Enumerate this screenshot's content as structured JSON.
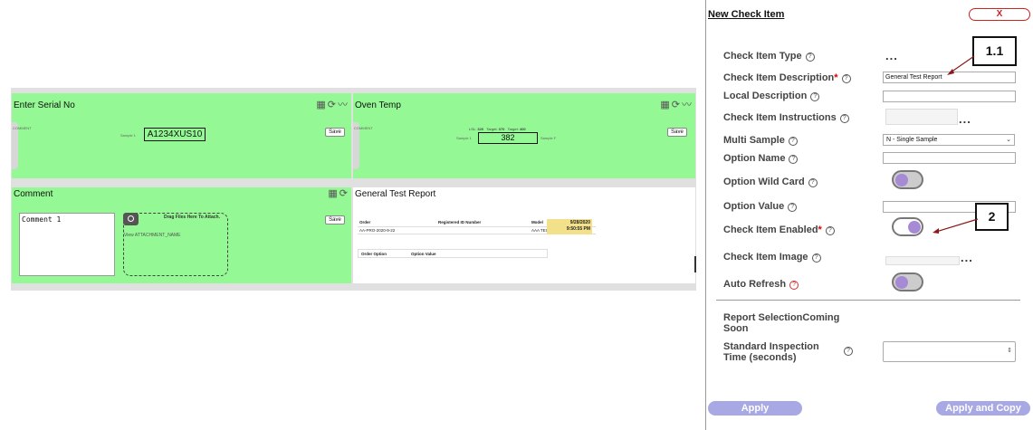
{
  "panels": {
    "serial": {
      "title": "Enter Serial No",
      "sample_label": "Sample 1",
      "value": "A1234XUS10",
      "save": "Save",
      "strip": "COMMENT"
    },
    "oven": {
      "title": "Oven Temp",
      "lsl_label": "LSL:",
      "lsl": "320",
      "target_label": "Target:",
      "target": "370",
      "usl_label": "Target:",
      "usl": "400",
      "sample_label": "Sample 1",
      "value": "382",
      "right_label": "Sample F",
      "save": "Save",
      "strip": "COMMENT"
    },
    "comment": {
      "title": "Comment",
      "value": "Comment 1",
      "drag_text": "Drag Files Here To Attach.",
      "view_attachment": "View ATTACHMENT_NAME",
      "save": "Save"
    },
    "report": {
      "title": "General Test Report",
      "headers": [
        "Order",
        "Registered ID Number",
        "Model"
      ],
      "row": [
        "AA-PRO-2020-9-22",
        "",
        "AAA TEST PRO"
      ],
      "date": "9/28/2020",
      "time": "9:50:55 PM",
      "option_headers": [
        "Order Option",
        "Option Value"
      ]
    },
    "icons": [
      "table-icon",
      "refresh-icon",
      "chart-icon"
    ]
  },
  "dialog": {
    "title": "New Check Item",
    "close": "X",
    "fields": {
      "type": {
        "label": "Check Item Type",
        "value": "..."
      },
      "description": {
        "label": "Check Item Description",
        "required": "*",
        "value": "General Test Report"
      },
      "local_description": {
        "label": "Local Description"
      },
      "instructions": {
        "label": "Check Item Instructions",
        "dots": "..."
      },
      "multi_sample": {
        "label": "Multi Sample",
        "value": "N - Single Sample"
      },
      "option_name": {
        "label": "Option Name"
      },
      "option_wildcard": {
        "label": "Option Wild Card"
      },
      "option_value": {
        "label": "Option Value"
      },
      "enabled": {
        "label": "Check Item Enabled",
        "required": "*"
      },
      "image": {
        "label": "Check Item Image",
        "dots": "..."
      },
      "auto_refresh": {
        "label": "Auto Refresh"
      },
      "report_selection": {
        "label": "Report SelectionComing Soon"
      },
      "inspection_time": {
        "label": "Standard Inspection Time (seconds)"
      }
    },
    "apply": "Apply",
    "apply_copy": "Apply and Copy"
  },
  "annotations": [
    "1.1",
    "2"
  ],
  "colors": {
    "panel_green": "#94f894",
    "toggle_knob": "#a68ad4",
    "button": "#a8a8e4",
    "arrow": "#8b1a1a"
  }
}
